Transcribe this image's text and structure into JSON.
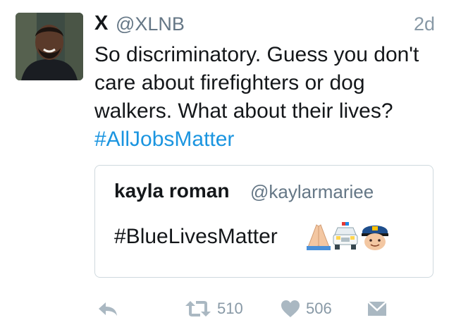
{
  "tweet": {
    "display_name": "X",
    "handle": "@XLNB",
    "time": "2d",
    "text_main": "So discriminatory. Guess you don't care about firefighters or dog walkers. What about their lives? ",
    "hashtag": "#AllJobsMatter"
  },
  "quoted": {
    "display_name": "kayla roman",
    "handle": "@kaylarmariee",
    "text": "#BlueLivesMatter",
    "emojis": [
      "folded-hands-emoji",
      "police-car-emoji",
      "police-officer-emoji"
    ]
  },
  "actions": {
    "reply_icon": "reply-icon",
    "retweet_icon": "retweet-icon",
    "retweet_count": "510",
    "like_icon": "heart-icon",
    "like_count": "506",
    "dm_icon": "envelope-icon"
  },
  "colors": {
    "link": "#1b95e0",
    "muted": "#8899a6",
    "text": "#14171a",
    "border": "#cfd9de"
  }
}
